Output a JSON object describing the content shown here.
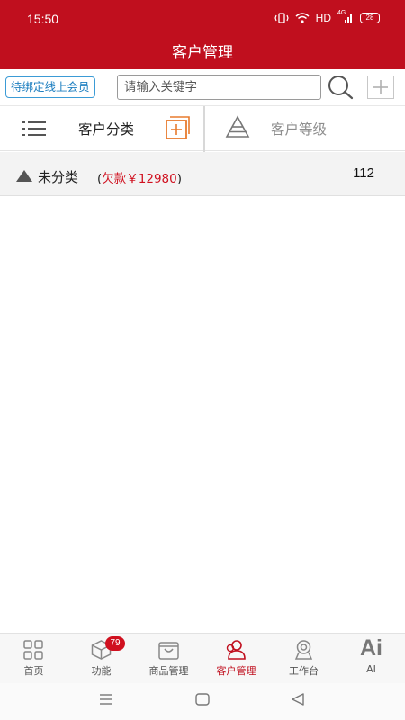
{
  "status_bar": {
    "time": "15:50",
    "network": "HD",
    "signal_label": "4G",
    "battery": "28",
    "icons": [
      "vibrate-icon",
      "wifi-icon",
      "signal-icon",
      "battery-icon"
    ]
  },
  "header": {
    "title": "客户管理",
    "background_color": "#c00f1e"
  },
  "search": {
    "bind_tag_label": "待绑定线上会员",
    "placeholder": "请输入关键字",
    "value": ""
  },
  "tabs": {
    "category_label": "客户分类",
    "level_label": "客户等级"
  },
  "categories": [
    {
      "name": "未分类",
      "debt_open": "(",
      "debt_text": "欠款￥12980",
      "debt_close": ")",
      "count": "112"
    }
  ],
  "bottom_nav": {
    "items": [
      {
        "label": "首页",
        "icon": "home-grid-icon"
      },
      {
        "label": "功能",
        "icon": "cube-icon",
        "badge": "79"
      },
      {
        "label": "商品管理",
        "icon": "bag-icon"
      },
      {
        "label": "客户管理",
        "icon": "customers-icon",
        "active": true
      },
      {
        "label": "工作台",
        "icon": "workbench-icon"
      },
      {
        "label": "AI",
        "icon": "ai-icon",
        "glyph": "Ai"
      }
    ],
    "active_color": "#c00f1e"
  }
}
